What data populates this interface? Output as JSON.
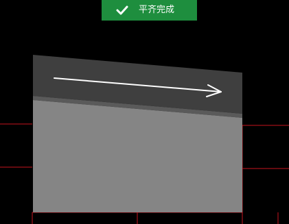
{
  "toast": {
    "icon": "checkmark-icon",
    "message": "平齐完成",
    "color": "#1e8e3e"
  },
  "colors": {
    "background": "#000000",
    "guide_lines": "#c8141e",
    "top_face": "#3f3f3f",
    "bevel_edge": "#5a5a5a",
    "front_face": "#858585",
    "direction_arrow": "#ffffff"
  },
  "icons": {
    "direction_arrow": "arrow-right-icon"
  }
}
